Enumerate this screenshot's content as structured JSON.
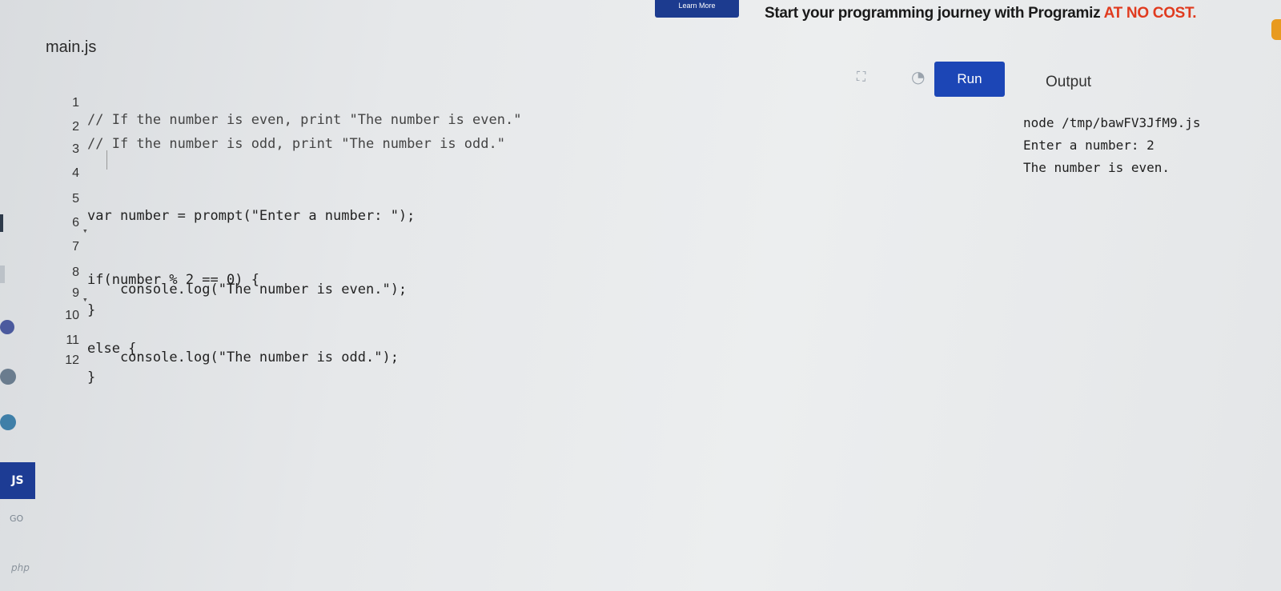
{
  "banner": {
    "learn_more": "Learn More",
    "text": "Start your programming journey with Programiz ",
    "accent": "AT NO COST."
  },
  "languages": {
    "js": "JS",
    "go": "GO",
    "php": "php"
  },
  "editor": {
    "file_name": "main.js",
    "run_label": "Run",
    "lines": [
      {
        "n": "1",
        "text": "// If the number is even, print \"The number is even.\""
      },
      {
        "n": "2",
        "text": "// If the number is odd, print \"The number is odd.\""
      },
      {
        "n": "3",
        "text": ""
      },
      {
        "n": "4",
        "text": ""
      },
      {
        "n": "5",
        "text": "var number = prompt(\"Enter a number: \");"
      },
      {
        "n": "6",
        "text": ""
      },
      {
        "n": "7",
        "text": "if(number % 2 == 0) {"
      },
      {
        "n": "8",
        "text": "    console.log(\"The number is even.\");"
      },
      {
        "n": "9",
        "text": "}"
      },
      {
        "n": "10",
        "text": "else {"
      },
      {
        "n": "11",
        "text": "    console.log(\"The number is odd.\");"
      },
      {
        "n": "12",
        "text": "}"
      }
    ]
  },
  "output": {
    "label": "Output",
    "lines": [
      "node /tmp/bawFV3JfM9.js",
      "Enter a number: 2",
      "The number is even."
    ]
  },
  "colors": {
    "run_button": "#1c46b6",
    "banner_accent": "#e03b1f",
    "js_tab": "#1d3c94"
  }
}
